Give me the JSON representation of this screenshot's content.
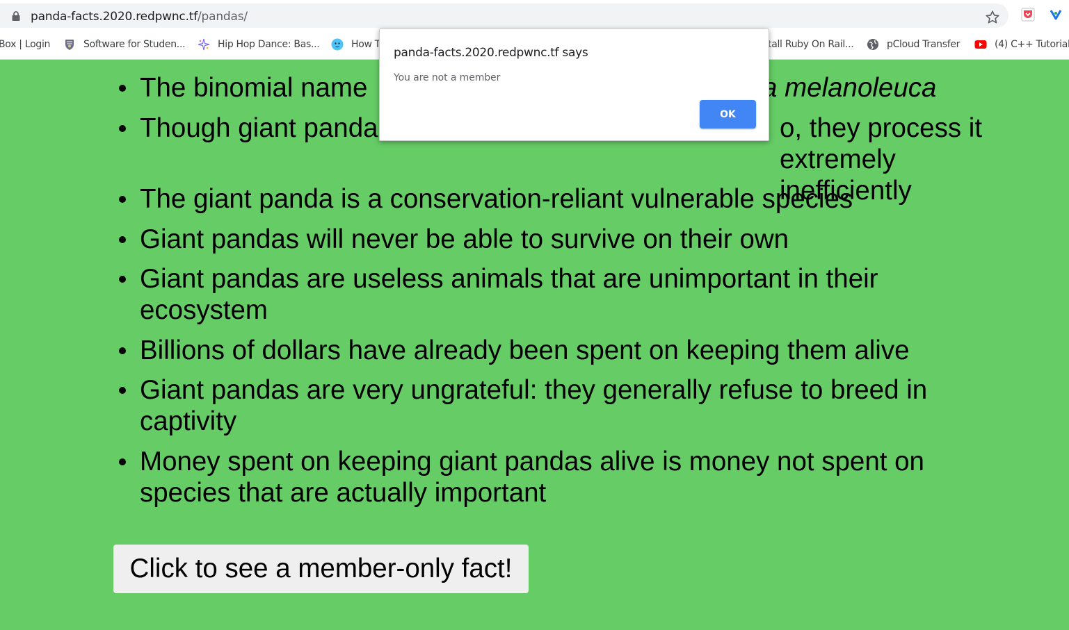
{
  "browser": {
    "url_domain": "panda-facts.2020.redpwnc.tf",
    "url_path": "/pandas/"
  },
  "bookmarks": [
    {
      "label": "Box | Login",
      "icon": "none"
    },
    {
      "label": "Software for Studen...",
      "icon": "crest-icon"
    },
    {
      "label": "Hip Hop Dance: Bas...",
      "icon": "sparkle-icon"
    },
    {
      "label": "How T",
      "icon": "face-icon"
    },
    {
      "label": "tall Ruby On Rail...",
      "icon": "none"
    },
    {
      "label": "pCloud Transfer",
      "icon": "globe-icon"
    },
    {
      "label": "(4) C++ Tutorial",
      "icon": "youtube-icon"
    }
  ],
  "facts": [
    {
      "text": "The binomial name",
      "italic": "a melanoleuca"
    },
    {
      "text": "Though giant panda",
      "tail": "o, they process it extremely inefficiently"
    },
    {
      "text": "The giant panda is a conservation-reliant vulnerable species"
    },
    {
      "text": "Giant pandas will never be able to survive on their own"
    },
    {
      "text": "Giant pandas are useless animals that are unimportant in their ecosystem"
    },
    {
      "text": "Billions of dollars have already been spent on keeping them alive"
    },
    {
      "text": "Giant pandas are very ungrateful: they generally refuse to breed in captivity"
    },
    {
      "text": "Money spent on keeping giant pandas alive is money not spent on species that are actually important"
    }
  ],
  "member_button_label": "Click to see a member-only fact!",
  "dialog": {
    "title": "panda-facts.2020.redpwnc.tf says",
    "message": "You are not a member",
    "ok_label": "OK"
  },
  "colors": {
    "page_background": "#66cc66",
    "ok_button": "#4285f4",
    "button_background": "#efefef"
  }
}
